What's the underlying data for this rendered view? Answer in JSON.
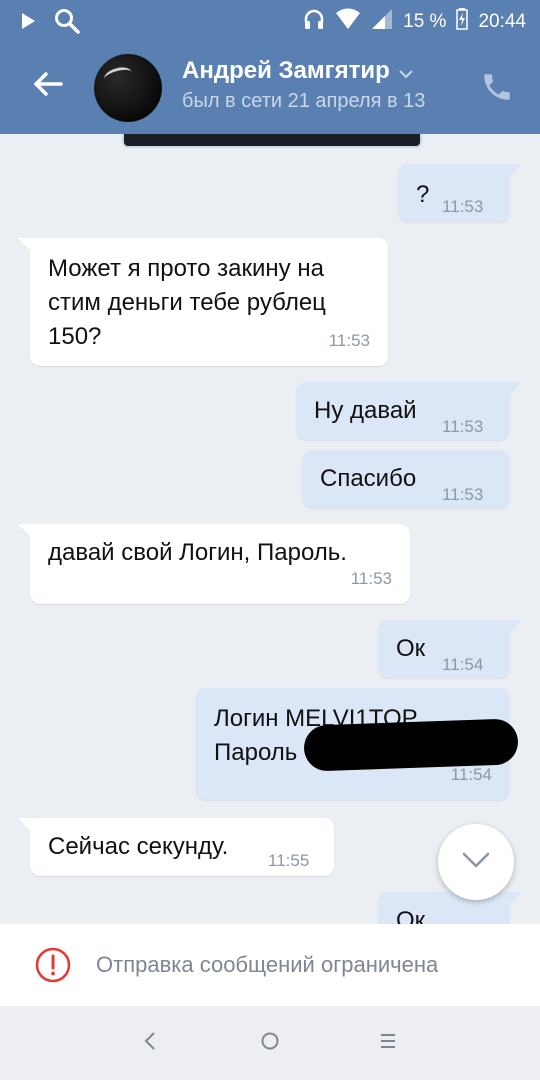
{
  "status_bar": {
    "battery": "15 %",
    "time": "20:44",
    "icons": [
      "play-icon",
      "search-icon",
      "headphones-icon",
      "wifi-icon",
      "signal-icon",
      "battery-icon"
    ]
  },
  "header": {
    "contact_name": "Андрей Замгятир",
    "contact_status": "был в сети 21 апреля в 13",
    "icons": [
      "back-arrow-icon",
      "avatar",
      "chevron-down-icon",
      "phone-icon"
    ]
  },
  "messages": [
    {
      "direction": "out",
      "text": "?",
      "time": "11:53"
    },
    {
      "direction": "in",
      "lines": [
        "Может я прото закину на",
        "стим деньги тебе рублец",
        "150?"
      ],
      "time": "11:53"
    },
    {
      "direction": "out",
      "text": "Ну давай",
      "time": "11:53"
    },
    {
      "direction": "out",
      "text": "Спасибо",
      "time": "11:53"
    },
    {
      "direction": "in",
      "text": "давай свой Логин, Пароль.",
      "time": "11:53"
    },
    {
      "direction": "out",
      "text": "Ок",
      "time": "11:54"
    },
    {
      "direction": "out",
      "lines": [
        "Логин MELVI1TOP",
        "Пароль"
      ],
      "time": "11:54"
    },
    {
      "direction": "in",
      "text": "Сейчас секунду.",
      "time": "11:55"
    },
    {
      "direction": "out",
      "text": "Ок",
      "time": ""
    }
  ],
  "banner": {
    "text": "Отправка сообщений ограничена",
    "icon": "alert-circle-icon",
    "icon_color": "#e53935"
  },
  "nav": {
    "icons": [
      "nav-back-icon",
      "nav-home-icon",
      "nav-menu-icon"
    ]
  },
  "colors": {
    "header": "#5a80b1",
    "chat_background": "#ebeef2",
    "incoming_bubble": "#ffffff",
    "outgoing_bubble": "#dbe6f6"
  }
}
